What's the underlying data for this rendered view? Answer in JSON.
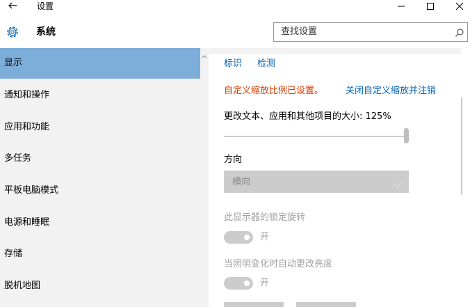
{
  "window": {
    "title": "设置",
    "back_icon": "back-arrow-icon",
    "minimize_icon": "minimize-icon",
    "maximize_icon": "maximize-icon",
    "close_icon": "close-icon"
  },
  "header": {
    "icon": "gear-icon",
    "title": "系统",
    "search_placeholder": "查找设置",
    "search_icon": "search-icon"
  },
  "sidebar": {
    "items": [
      {
        "label": "显示",
        "selected": true
      },
      {
        "label": "通知和操作",
        "selected": false
      },
      {
        "label": "应用和功能",
        "selected": false
      },
      {
        "label": "多任务",
        "selected": false
      },
      {
        "label": "平板电脑模式",
        "selected": false
      },
      {
        "label": "电源和睡眠",
        "selected": false
      },
      {
        "label": "存储",
        "selected": false
      },
      {
        "label": "脱机地图",
        "selected": false
      }
    ],
    "selected_color": "#7dadd9"
  },
  "content": {
    "identify_link": "标识",
    "detect_link": "检测",
    "custom_scaling_warning": "自定义缩放比例已设置。",
    "custom_scaling_link": "关闭自定义缩放并注销",
    "scale_label": "更改文本、应用和其他项目的大小: 125%",
    "scale_slider_level": 1.0,
    "orientation_label": "方向",
    "orientation_value": "横向",
    "rotation_lock_label": "此显示器的锁定旋转",
    "rotation_lock_state": "开",
    "auto_brightness_label": "当照明变化时自动更改亮度",
    "auto_brightness_state": "开"
  },
  "colors": {
    "link": "#0063b1",
    "warning": "#d83b01",
    "disabled": "#cccccc"
  }
}
